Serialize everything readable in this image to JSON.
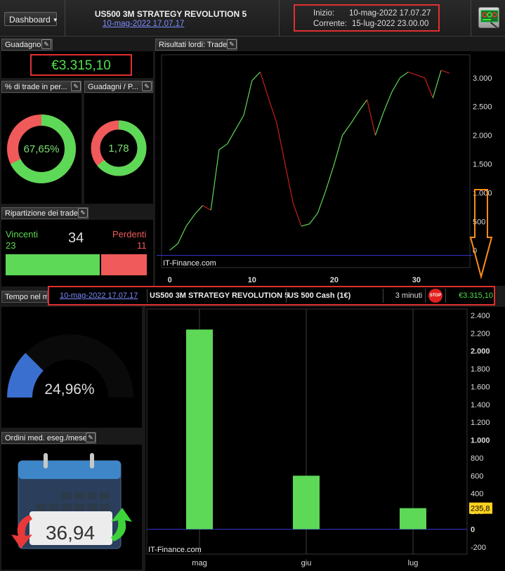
{
  "topbar": {
    "dashboard_label": "Dashboard",
    "strategy_title": "US500 3M STRATEGY REVOLUTION 5",
    "strategy_date": "10-mag-2022 17.07.17",
    "start_label": "Inizio:",
    "start_value": "10-mag-2022 17.07.27",
    "current_label": "Corrente:",
    "current_value": "15-lug-2022 23.00.00"
  },
  "panels": {
    "profit_title": "Guadagno",
    "profit_value": "€3.315,10",
    "winpct_title": "% di trade in per...",
    "winpct_value": "67,65%",
    "winpct_fraction": 0.6765,
    "gainloss_title": "Guadagni / P...",
    "gainloss_value": "1,78",
    "gainloss_fraction": 0.64,
    "breakdown_title": "Ripartizione dei trade",
    "winners_label": "Vincenti",
    "winners_count": "23",
    "total_count": "34",
    "losers_label": "Perdenti",
    "losers_count": "11",
    "time_title": "Tempo nel m",
    "time_value": "24,96%",
    "time_fraction": 0.2496,
    "orders_title": "Ordini med. eseg./mese",
    "orders_value": "36,94"
  },
  "highlight_row": {
    "date": "10-mag-2022 17.07.17",
    "strategy": "US500 3M STRATEGY REVOLUTION 5",
    "instrument": "US 500 Cash (1€)",
    "timeframe": "3 minuti",
    "stop_label": "STOP",
    "profit": "€3.315,10"
  },
  "colors": {
    "positive": "#4ee04a",
    "negative": "#f05a5a",
    "highlight_border": "#e03030",
    "arrow": "#ff8c1a",
    "zero_line": "#3333cc"
  },
  "chart_data": [
    {
      "type": "line",
      "title": "Risultati lordi: Trade",
      "watermark": "IT-Finance.com",
      "x": [
        0,
        1,
        2,
        3,
        4,
        5,
        6,
        7,
        8,
        9,
        10,
        11,
        12,
        13,
        14,
        15,
        16,
        17,
        18,
        19,
        20,
        21,
        22,
        23,
        24,
        25,
        26,
        27,
        28,
        29,
        30,
        31,
        32,
        33,
        34
      ],
      "y": [
        0,
        120,
        420,
        620,
        780,
        700,
        1750,
        1850,
        2100,
        2350,
        2950,
        3100,
        2650,
        2220,
        1520,
        820,
        420,
        460,
        650,
        1050,
        1500,
        2000,
        2200,
        2420,
        2620,
        2000,
        2400,
        2750,
        3000,
        3100,
        3050,
        3000,
        2650,
        3130,
        3080
      ],
      "x_ticks": [
        0,
        10,
        20,
        30
      ],
      "y_ticks": [
        "0",
        "500",
        "1.000",
        "1.500",
        "2.000",
        "2.500",
        "3.000"
      ],
      "xlim": [
        -1,
        36.5
      ],
      "ylim": [
        -300,
        3400
      ]
    },
    {
      "type": "bar",
      "title": "",
      "watermark": "IT-Finance.com",
      "categories": [
        "mag",
        "giu",
        "lug"
      ],
      "values": [
        2240,
        600,
        235.8
      ],
      "last_value_label": "235,8",
      "y_ticks": [
        "-200",
        "0",
        "200",
        "400",
        "600",
        "800",
        "1.000",
        "1.200",
        "1.400",
        "1.600",
        "1.800",
        "2.000",
        "2.200",
        "2.400"
      ],
      "ylim": [
        -280,
        2470
      ]
    }
  ]
}
